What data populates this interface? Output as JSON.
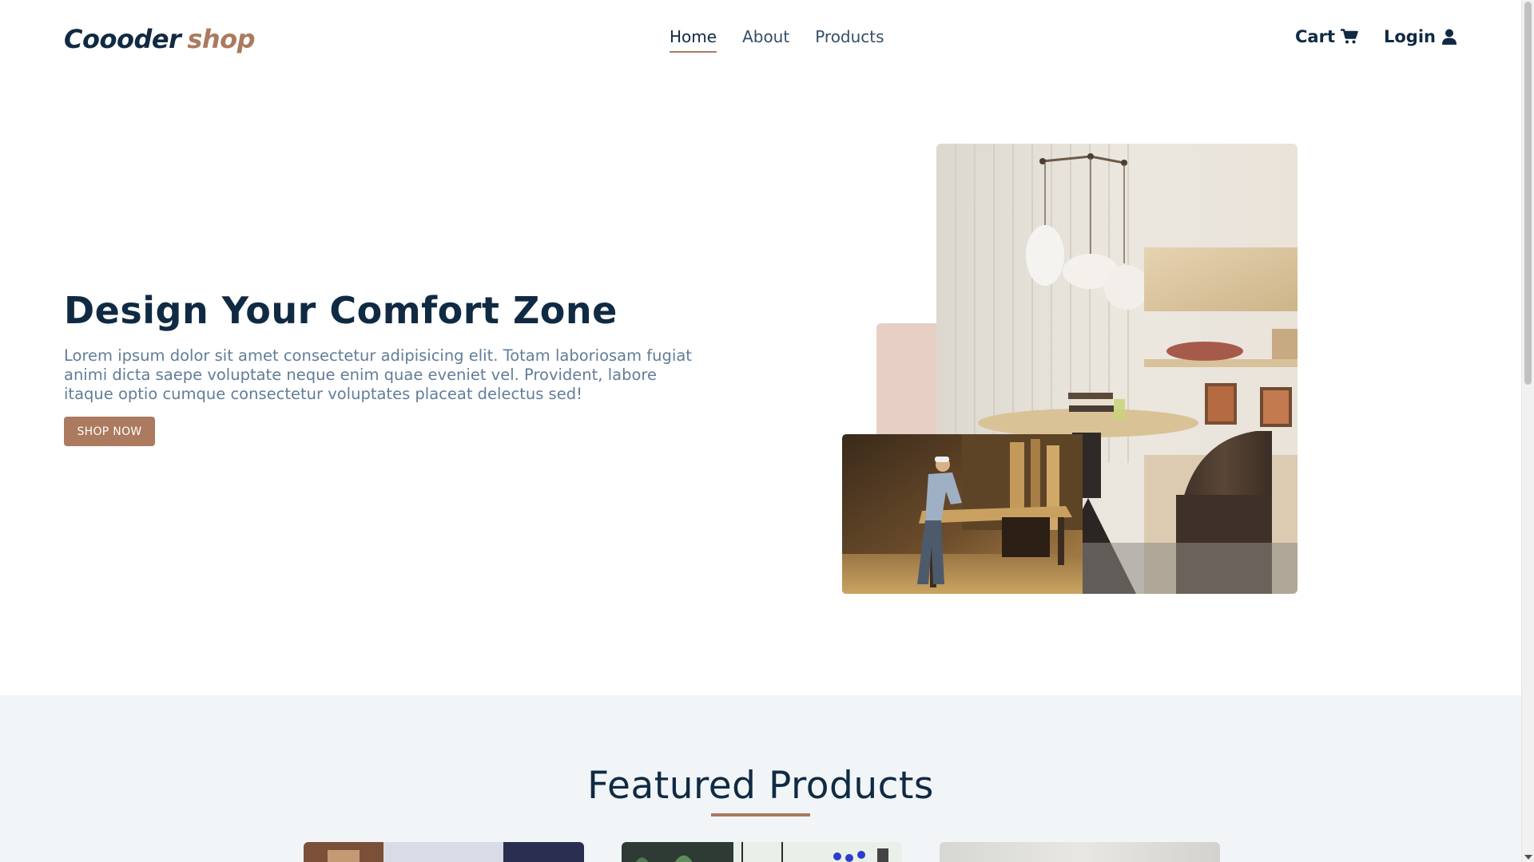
{
  "brand": {
    "name": "Coooder",
    "accent": "shop"
  },
  "nav": {
    "items": [
      {
        "label": "Home",
        "active": true
      },
      {
        "label": "About",
        "active": false
      },
      {
        "label": "Products",
        "active": false
      }
    ]
  },
  "header_actions": {
    "cart_label": "Cart",
    "cart_icon": "shopping-cart-icon",
    "login_label": "Login",
    "login_icon": "user-icon"
  },
  "hero": {
    "title": "Design Your Comfort Zone",
    "text": "Lorem ipsum dolor sit amet consectetur adipisicing elit. Totam laboriosam fugiat animi dicta saepe voluptate neque enim quae eveniet vel. Provident, labore itaque optio cumque consectetur voluptates placeat delectus sed!",
    "cta_label": "SHOP NOW"
  },
  "featured": {
    "title": "Featured Products"
  },
  "colors": {
    "primary": "#ab7a5f",
    "heading": "#102a43",
    "body_text": "#617d98",
    "accent_block": "#e7cfc5",
    "section_background": "#f1f5f8"
  }
}
